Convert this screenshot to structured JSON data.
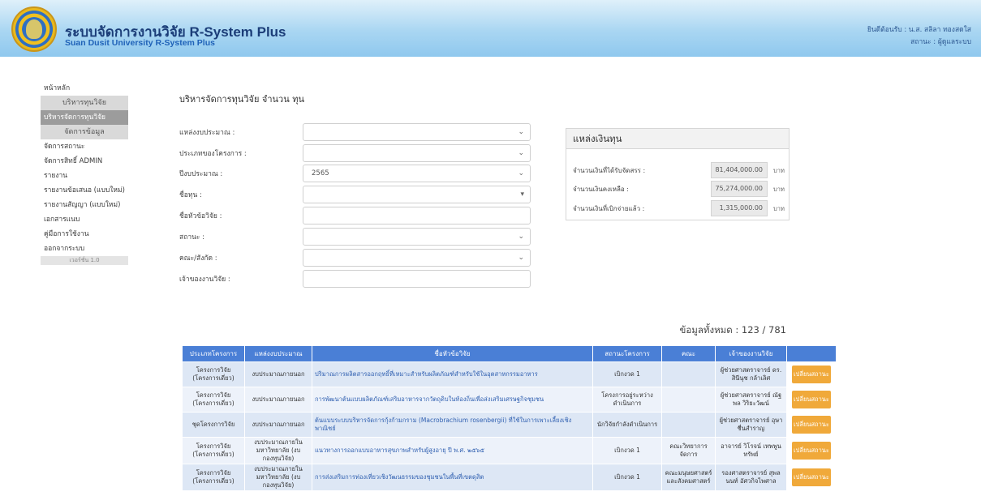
{
  "header": {
    "title_th": "ระบบจัดการงานวิจัย R-System Plus",
    "title_en": "Suan Dusit University R-System Plus",
    "user_line": "ยินดีต้อนรับ : น.ส. สลิลา ทองสดใส",
    "role_line": "สถานะ : ผู้ดูแลระบบ"
  },
  "sidebar": {
    "home": "หน้าหลัก",
    "section1": "บริหารทุนวิจัย",
    "active": "บริหารจัดการทุนวิจัย",
    "section2": "จัดการข้อมูล",
    "items": [
      "จัดการสถานะ",
      "จัดการสิทธิ์ ADMIN",
      "รายงาน",
      "รายงานข้อเสนอ (แบบใหม่)",
      "รายงานสัญญา (แบบใหม่)",
      "เอกสารแนบ",
      "คู่มือการใช้งาน",
      "ออกจากระบบ"
    ],
    "version": "เวอร์ชั่น 1.0"
  },
  "page": {
    "title": "บริหารจัดการทุนวิจัย จำนวน ทุน"
  },
  "form": {
    "fields": [
      {
        "label": "แหล่งงบประมาณ :",
        "value": ""
      },
      {
        "label": "ประเภทของโครงการ :",
        "value": ""
      },
      {
        "label": "ปีงบประมาณ :",
        "value": "2565"
      },
      {
        "label": "ชื่อทุน :",
        "value": ""
      },
      {
        "label": "ชื่อหัวข้อวิจัย :",
        "value": ""
      },
      {
        "label": "สถานะ :",
        "value": ""
      },
      {
        "label": "คณะ/สังกัด :",
        "value": ""
      },
      {
        "label": "เจ้าของงานวิจัย :",
        "value": ""
      }
    ]
  },
  "fund": {
    "title": "แหล่งเงินทุน",
    "rows": [
      {
        "label": "จำนวนเงินที่ได้รับจัดสรร :",
        "value": "81,404,000.00",
        "unit": "บาท"
      },
      {
        "label": "จำนวนเงินคงเหลือ :",
        "value": "75,274,000.00",
        "unit": "บาท"
      },
      {
        "label": "จำนวนเงินที่เบิกจ่ายแล้ว :",
        "value": "1,315,000.00",
        "unit": "บาท"
      }
    ]
  },
  "table": {
    "count_text": "ข้อมูลทั้งหมด : 123 / 781",
    "headers": [
      "ประเภทโครงการ",
      "แหล่งงบประมาณ",
      "ชื่อหัวข้อวิจัย",
      "สถานะโครงการ",
      "คณะ",
      "เจ้าของงานวิจัย",
      ""
    ],
    "rows": [
      [
        "โครงการวิจัย (โครงการเดี่ยว)",
        "งบประมาณภายนอก",
        "ปริมาณการผลิตสารออกฤทธิ์ที่เหมาะสำหรับผลิตภัณฑ์สำหรับใช้ในอุตสาหกรรมอาหาร",
        "เบิกงวด 1",
        "",
        "ผู้ช่วยศาสตราจารย์ ดร. สินีนุช กล้าเลิศ",
        "เปลี่ยนสถานะ"
      ],
      [
        "โครงการวิจัย (โครงการเดี่ยว)",
        "งบประมาณภายนอก",
        "การพัฒนาต้นแบบผลิตภัณฑ์เสริมอาหารจากวัตถุดิบในท้องถิ่นเพื่อส่งเสริมเศรษฐกิจชุมชน",
        "โครงการอยู่ระหว่างดำเนินการ",
        "",
        "ผู้ช่วยศาสตราจารย์ ณัฐพล วิริยะวัฒน์",
        "เปลี่ยนสถานะ"
      ],
      [
        "ชุดโครงการวิจัย",
        "งบประมาณภายนอก",
        "ต้นแบบระบบบริหารจัดการกุ้งก้ามกราม (Macrobrachium rosenbergii) ที่ใช้ในการเพาะเลี้ยงเชิงพาณิชย์",
        "นักวิจัยกำลังดำเนินการ",
        "",
        "ผู้ช่วยศาสตราจารย์ อุษา ชื่นสำราญ",
        "เปลี่ยนสถานะ"
      ],
      [
        "โครงการวิจัย (โครงการเดี่ยว)",
        "งบประมาณภายในมหาวิทยาลัย (งบกองทุนวิจัย)",
        "แนวทางการออกแบบอาหารสุขภาพสำหรับผู้สูงอายุ ปี พ.ศ. ๒๕๖๕",
        "เบิกงวด 1",
        "คณะวิทยาการจัดการ",
        "อาจารย์ วิโรจน์ เทพพูนทรัพย์",
        "เปลี่ยนสถานะ"
      ],
      [
        "โครงการวิจัย (โครงการเดี่ยว)",
        "งบประมาณภายในมหาวิทยาลัย (งบกองทุนวิจัย)",
        "การส่งเสริมการท่องเที่ยวเชิงวัฒนธรรมของชุมชนในพื้นที่เขตดุสิต",
        "เบิกงวด 1",
        "คณะมนุษยศาสตร์และสังคมศาสตร์",
        "รองศาสตราจารย์ สุพล นนท์ อัศวกิจไพศาล",
        "เปลี่ยนสถานะ"
      ]
    ]
  }
}
